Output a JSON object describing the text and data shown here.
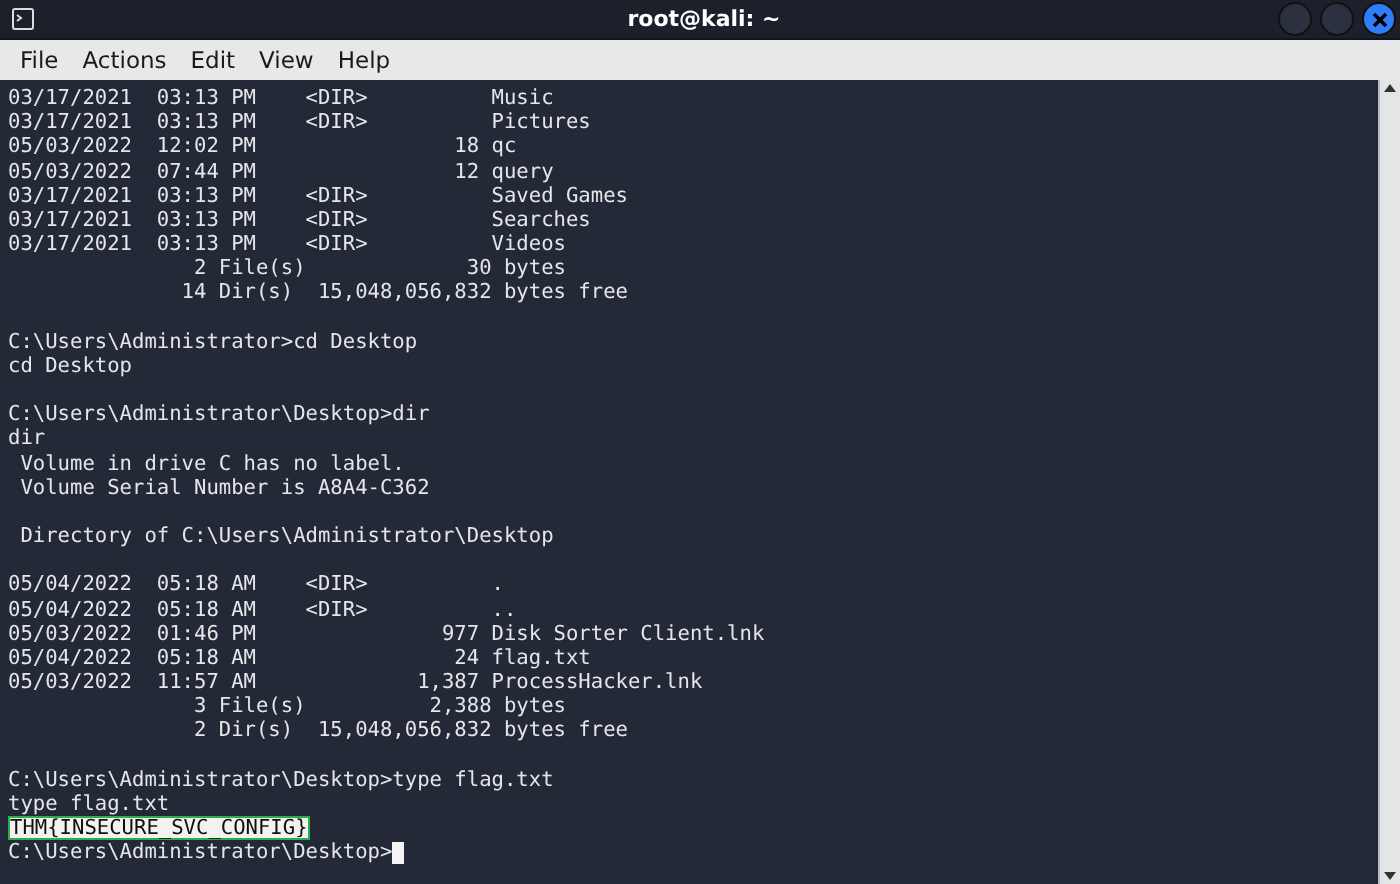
{
  "window": {
    "title": "root@kali: ~"
  },
  "menu": [
    "File",
    "Actions",
    "Edit",
    "View",
    "Help"
  ],
  "terminal": {
    "lines": [
      {
        "kind": "text",
        "text": "03/17/2021  03:13 PM    <DIR>          Music"
      },
      {
        "kind": "text",
        "text": "03/17/2021  03:13 PM    <DIR>          Pictures"
      },
      {
        "kind": "text",
        "text": "05/03/2022  12:02 PM                18 qc"
      },
      {
        "kind": "text",
        "text": "05/03/2022  07:44 PM                12 query"
      },
      {
        "kind": "text",
        "text": "03/17/2021  03:13 PM    <DIR>          Saved Games"
      },
      {
        "kind": "text",
        "text": "03/17/2021  03:13 PM    <DIR>          Searches"
      },
      {
        "kind": "text",
        "text": "03/17/2021  03:13 PM    <DIR>          Videos"
      },
      {
        "kind": "text",
        "text": "               2 File(s)             30 bytes"
      },
      {
        "kind": "text",
        "text": "              14 Dir(s)  15,048,056,832 bytes free"
      },
      {
        "kind": "blank"
      },
      {
        "kind": "text",
        "text": "C:\\Users\\Administrator>cd Desktop"
      },
      {
        "kind": "text",
        "text": "cd Desktop"
      },
      {
        "kind": "blank"
      },
      {
        "kind": "text",
        "text": "C:\\Users\\Administrator\\Desktop>dir"
      },
      {
        "kind": "text",
        "text": "dir"
      },
      {
        "kind": "text",
        "text": " Volume in drive C has no label."
      },
      {
        "kind": "text",
        "text": " Volume Serial Number is A8A4-C362"
      },
      {
        "kind": "blank"
      },
      {
        "kind": "text",
        "text": " Directory of C:\\Users\\Administrator\\Desktop"
      },
      {
        "kind": "blank"
      },
      {
        "kind": "text",
        "text": "05/04/2022  05:18 AM    <DIR>          ."
      },
      {
        "kind": "text",
        "text": "05/04/2022  05:18 AM    <DIR>          .."
      },
      {
        "kind": "text",
        "text": "05/03/2022  01:46 PM               977 Disk Sorter Client.lnk"
      },
      {
        "kind": "text",
        "text": "05/04/2022  05:18 AM                24 flag.txt"
      },
      {
        "kind": "text",
        "text": "05/03/2022  11:57 AM             1,387 ProcessHacker.lnk"
      },
      {
        "kind": "text",
        "text": "               3 File(s)          2,388 bytes"
      },
      {
        "kind": "text",
        "text": "               2 Dir(s)  15,048,056,832 bytes free"
      },
      {
        "kind": "blank"
      },
      {
        "kind": "text",
        "text": "C:\\Users\\Administrator\\Desktop>type flag.txt"
      },
      {
        "kind": "text",
        "text": "type flag.txt"
      },
      {
        "kind": "boxed",
        "text": "THM{INSECURE_SVC_CONFIG}"
      },
      {
        "kind": "cursor",
        "text": "C:\\Users\\Administrator\\Desktop>"
      }
    ]
  }
}
